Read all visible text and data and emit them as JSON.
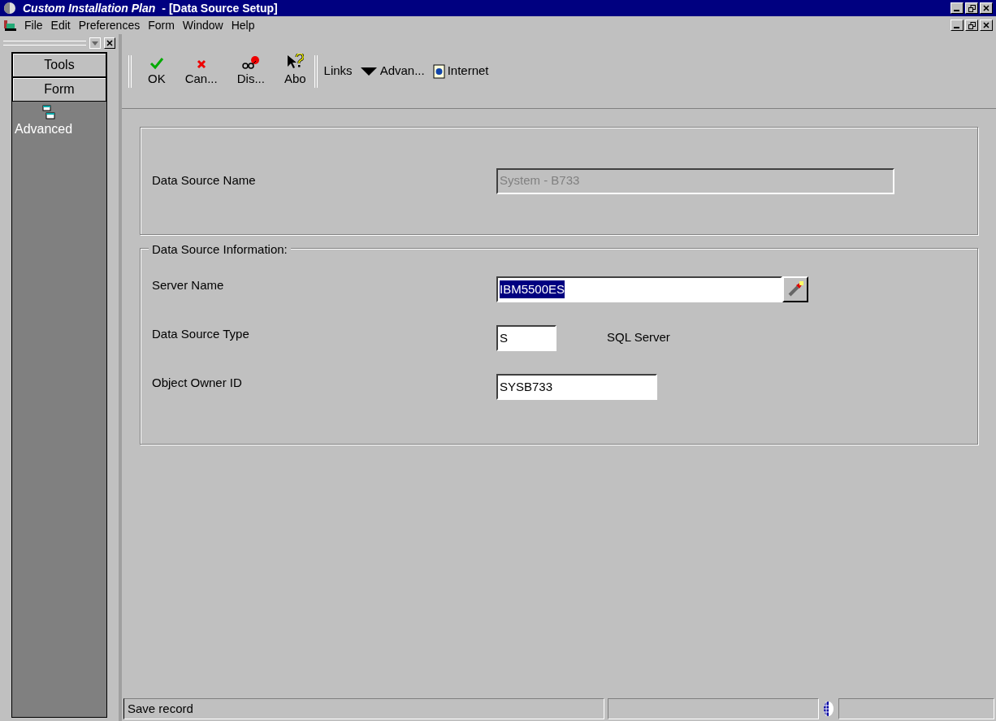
{
  "window": {
    "title": "Custom Installation Plan",
    "subtitle": "- [Data Source Setup]"
  },
  "menu": [
    "File",
    "Edit",
    "Preferences",
    "Form",
    "Window",
    "Help"
  ],
  "toolbar": [
    {
      "kind": "ok",
      "label": "OK"
    },
    {
      "kind": "cancel",
      "label": "Can..."
    },
    {
      "kind": "display",
      "label": "Dis..."
    },
    {
      "kind": "about",
      "label": "Abo"
    }
  ],
  "links": [
    {
      "kind": "text",
      "label": "Links"
    },
    {
      "kind": "dropdown",
      "label": "Advan..."
    },
    {
      "kind": "internet",
      "label": "Internet"
    }
  ],
  "sidebar": {
    "buttons": [
      "Tools",
      "Form"
    ],
    "items": [
      {
        "label": "Advanced"
      }
    ]
  },
  "header_section": {
    "fields": [
      {
        "label": "Data Source Name",
        "value": "System - B733",
        "disabled": true
      }
    ]
  },
  "info_section": {
    "title": "Data Source Information:",
    "fields": [
      {
        "label": "Server Name",
        "value": "IBM5500ES",
        "selected": true,
        "kind": "lookup"
      },
      {
        "label": "Data Source Type",
        "value": "S",
        "selected": false,
        "kind": "short",
        "description": "SQL Server"
      },
      {
        "label": "Object Owner ID",
        "value": "SYSB733",
        "selected": false,
        "kind": "medium"
      }
    ]
  },
  "status_bar": {
    "message": "Save record"
  }
}
